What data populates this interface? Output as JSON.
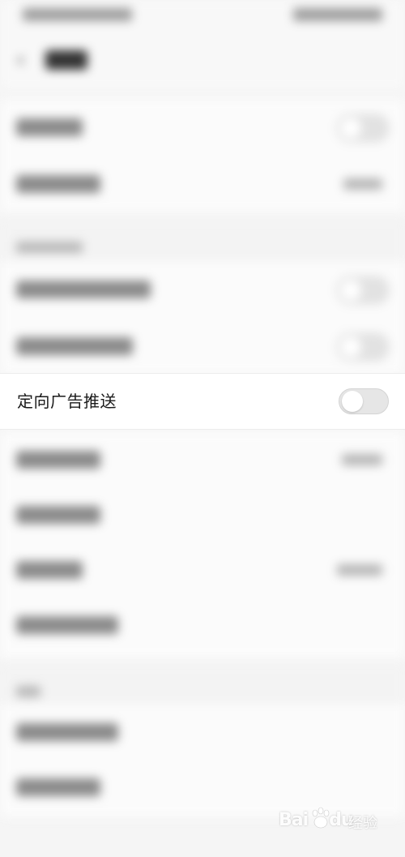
{
  "settings": {
    "focused_row": {
      "label": "定向广告推送",
      "toggle_state": "off"
    }
  },
  "watermark": {
    "logo_text": "Bai",
    "logo_text_tail": "du",
    "sub_text": "经验"
  },
  "colors": {
    "background": "#f5f5f5",
    "row_background": "#ffffff",
    "toggle_track": "#e6e6e6",
    "toggle_knob": "#ffffff"
  }
}
